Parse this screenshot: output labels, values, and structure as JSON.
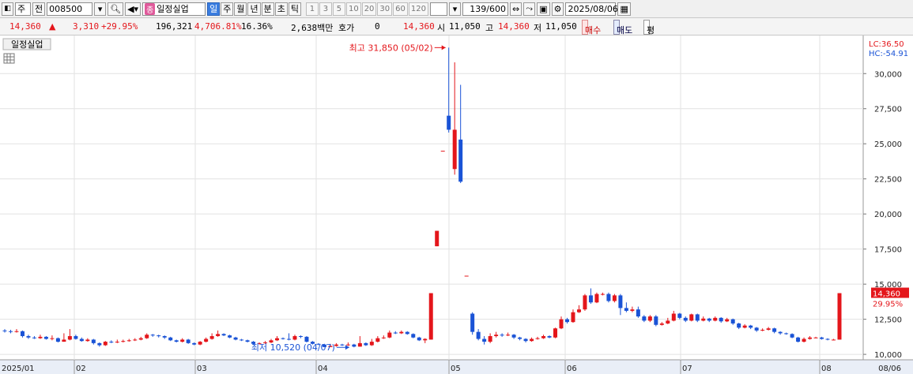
{
  "toolbar": {
    "menu_label": "주",
    "jeon_label": "전",
    "code": "008500",
    "badge": "종",
    "name": "일정실업",
    "periods": [
      "일",
      "주",
      "월",
      "년",
      "분",
      "초",
      "틱"
    ],
    "active_period": "일",
    "intervals": [
      "1",
      "3",
      "5",
      "10",
      "20",
      "30",
      "60",
      "120"
    ],
    "count": "139",
    "count_max": "/600",
    "date": "2025/08/06"
  },
  "quote": {
    "price": "14,360",
    "arrow": "up",
    "change": "3,310",
    "change_pct": "+29.95%",
    "volume": "196,321",
    "volume_ratio": "4,706.81%",
    "turnover": "16.36%",
    "amount": "2,638백만",
    "hoga_label": "호가",
    "hoga_value": "0",
    "hoga_price": "14,360",
    "open_label": "시",
    "open": "11,050",
    "high_label": "고",
    "high": "14,360",
    "low_label": "저",
    "low": "11,050",
    "buy_label": "매수",
    "sell_label": "매도",
    "avg_label": "평"
  },
  "chart_data": {
    "type": "candlestick",
    "title": "일정실업",
    "corner_labels": [
      "LC:36.50",
      "HC:-54.91"
    ],
    "y_ticks": [
      10000,
      12500,
      15000,
      17500,
      20000,
      22500,
      25000,
      27500,
      30000
    ],
    "ylim": [
      9500,
      32600
    ],
    "x_ticks": [
      "2025/01",
      "02",
      "03",
      "04",
      "05",
      "06",
      "07",
      "08",
      "08/06"
    ],
    "grid": true,
    "up_color": "#e4161b",
    "down_color": "#1a53d6",
    "max_annotation": "최고 31,850 (05/02)",
    "min_annotation": "최저 10,520 (04/07)",
    "last_price_label": "14,360",
    "last_change_label": "29.95%",
    "candles": [
      [
        11700,
        11650,
        11800,
        11550
      ],
      [
        11650,
        11600,
        11750,
        11500
      ],
      [
        11600,
        11650,
        11800,
        11550
      ],
      [
        11650,
        11300,
        11700,
        11200
      ],
      [
        11300,
        11200,
        11400,
        11100
      ],
      [
        11200,
        11150,
        11300,
        11100
      ],
      [
        11150,
        11250,
        11400,
        11100
      ],
      [
        11250,
        11100,
        11300,
        11050
      ],
      [
        11100,
        11150,
        11350,
        11000
      ],
      [
        11150,
        10900,
        11200,
        10850
      ],
      [
        10900,
        11050,
        11500,
        10900
      ],
      [
        11050,
        11300,
        11800,
        11000
      ],
      [
        11300,
        11100,
        11400,
        11050
      ],
      [
        11100,
        10950,
        11200,
        10900
      ],
      [
        10950,
        11050,
        11150,
        10900
      ],
      [
        11050,
        10800,
        11100,
        10700
      ],
      [
        10800,
        10650,
        10850,
        10550
      ],
      [
        10650,
        10900,
        10950,
        10600
      ],
      [
        10900,
        10850,
        11000,
        10800
      ],
      [
        10850,
        10900,
        11050,
        10800
      ],
      [
        10900,
        10950,
        11050,
        10850
      ],
      [
        10950,
        11000,
        11100,
        10900
      ],
      [
        11000,
        11050,
        11150,
        10950
      ],
      [
        11050,
        11150,
        11250,
        11000
      ],
      [
        11150,
        11400,
        11500,
        11100
      ],
      [
        11400,
        11350,
        11450,
        11250
      ],
      [
        11350,
        11300,
        11400,
        11200
      ],
      [
        11300,
        11200,
        11350,
        11100
      ],
      [
        11200,
        11000,
        11250,
        10950
      ],
      [
        11000,
        10900,
        11050,
        10850
      ],
      [
        10900,
        11050,
        11150,
        10850
      ],
      [
        11050,
        10800,
        11100,
        10750
      ],
      [
        10800,
        10700,
        10850,
        10650
      ],
      [
        10700,
        10900,
        10950,
        10650
      ],
      [
        10900,
        11100,
        11200,
        10850
      ],
      [
        11100,
        11300,
        11500,
        11050
      ],
      [
        11300,
        11450,
        11700,
        11250
      ],
      [
        11450,
        11350,
        11500,
        11300
      ],
      [
        11350,
        11200,
        11400,
        11150
      ],
      [
        11200,
        11050,
        11250,
        11000
      ],
      [
        11050,
        11000,
        11100,
        10950
      ],
      [
        11000,
        10900,
        11050,
        10850
      ],
      [
        10900,
        10750,
        10950,
        10700
      ],
      [
        10750,
        10800,
        10850,
        10700
      ],
      [
        10800,
        10850,
        10950,
        10750
      ],
      [
        10850,
        11000,
        11100,
        10800
      ],
      [
        11000,
        11150,
        11300,
        10950
      ],
      [
        11150,
        11100,
        11200,
        11050
      ],
      [
        11100,
        11050,
        11500,
        11000
      ],
      [
        11050,
        11300,
        11400,
        11000
      ],
      [
        11300,
        11250,
        11350,
        11150
      ],
      [
        11250,
        10900,
        11300,
        10850
      ],
      [
        10900,
        10750,
        10950,
        10700
      ],
      [
        10750,
        10700,
        10800,
        10650
      ],
      [
        10700,
        10520,
        10750,
        10520
      ],
      [
        10520,
        10600,
        10750,
        10520
      ],
      [
        10600,
        10700,
        10800,
        10550
      ],
      [
        10700,
        10650,
        10750,
        10600
      ],
      [
        10650,
        10700,
        10850,
        10600
      ],
      [
        10700,
        10550,
        10750,
        10500
      ],
      [
        10550,
        10800,
        11300,
        10550
      ],
      [
        10800,
        10650,
        10850,
        10600
      ],
      [
        10650,
        10900,
        11100,
        10600
      ],
      [
        10900,
        11150,
        11300,
        10850
      ],
      [
        11150,
        11200,
        11350,
        11100
      ],
      [
        11200,
        11550,
        11700,
        11150
      ],
      [
        11550,
        11500,
        11650,
        11450
      ],
      [
        11500,
        11600,
        11700,
        11450
      ],
      [
        11600,
        11450,
        11650,
        11400
      ],
      [
        11450,
        11200,
        11500,
        11150
      ],
      [
        11200,
        11000,
        11250,
        10950
      ],
      [
        11000,
        11100,
        11150,
        10800
      ],
      [
        11050,
        14360,
        14360,
        11050
      ],
      [
        17700,
        18800,
        18800,
        17700
      ],
      [
        24500,
        24500,
        24500,
        24500
      ],
      [
        27000,
        26000,
        31850,
        25800
      ],
      [
        23200,
        26000,
        30800,
        22800
      ],
      [
        25300,
        22300,
        29200,
        22200
      ],
      [
        15600,
        15600,
        15600,
        15600
      ],
      [
        12900,
        11600,
        13000,
        11400
      ],
      [
        11600,
        11100,
        11800,
        11000
      ],
      [
        11100,
        10900,
        11300,
        10700
      ],
      [
        10900,
        11300,
        11500,
        10800
      ],
      [
        11300,
        11400,
        11600,
        11200
      ],
      [
        11400,
        11350,
        11500,
        11250
      ],
      [
        11350,
        11400,
        11550,
        11300
      ],
      [
        11400,
        11200,
        11450,
        11100
      ],
      [
        11200,
        11100,
        11250,
        11000
      ],
      [
        11100,
        10950,
        11150,
        10850
      ],
      [
        10950,
        11100,
        11200,
        10900
      ],
      [
        11100,
        11150,
        11250,
        11050
      ],
      [
        11150,
        11300,
        11400,
        11100
      ],
      [
        11300,
        11200,
        11350,
        11150
      ],
      [
        11200,
        11850,
        11900,
        11150
      ],
      [
        11850,
        12500,
        12700,
        11800
      ],
      [
        12500,
        12300,
        12600,
        12200
      ],
      [
        12300,
        13000,
        13200,
        12250
      ],
      [
        13000,
        13200,
        13500,
        12950
      ],
      [
        13200,
        14200,
        14300,
        13100
      ],
      [
        14200,
        13700,
        14700,
        13600
      ],
      [
        13700,
        14300,
        14400,
        13650
      ],
      [
        14300,
        14300,
        14400,
        14200
      ],
      [
        14300,
        13800,
        14400,
        13700
      ],
      [
        13800,
        14200,
        14300,
        13700
      ],
      [
        14200,
        13300,
        14300,
        12800
      ],
      [
        13300,
        13100,
        13700,
        13000
      ],
      [
        13100,
        13200,
        13400,
        13000
      ],
      [
        13200,
        12700,
        13400,
        12600
      ],
      [
        12700,
        12400,
        12800,
        12300
      ],
      [
        12400,
        12700,
        12800,
        12300
      ],
      [
        12700,
        12100,
        12800,
        12000
      ],
      [
        12100,
        12200,
        12300,
        12050
      ],
      [
        12200,
        12400,
        12600,
        12150
      ],
      [
        12400,
        12900,
        13100,
        12350
      ],
      [
        12900,
        12600,
        12950,
        12500
      ],
      [
        12600,
        12400,
        12700,
        12300
      ],
      [
        12400,
        12850,
        12900,
        12350
      ],
      [
        12850,
        12400,
        12900,
        12300
      ],
      [
        12400,
        12550,
        12700,
        12350
      ],
      [
        12550,
        12400,
        12600,
        12300
      ],
      [
        12400,
        12600,
        12700,
        12350
      ],
      [
        12600,
        12350,
        12650,
        12250
      ],
      [
        12350,
        12500,
        12600,
        12300
      ],
      [
        12500,
        12200,
        12550,
        12100
      ],
      [
        12200,
        11900,
        12250,
        11800
      ],
      [
        11900,
        12050,
        12150,
        11850
      ],
      [
        12050,
        11900,
        12100,
        11800
      ],
      [
        11900,
        11700,
        11950,
        11600
      ],
      [
        11700,
        11750,
        11850,
        11650
      ],
      [
        11750,
        11850,
        11950,
        11700
      ],
      [
        11850,
        11600,
        11900,
        11500
      ],
      [
        11600,
        11500,
        11650,
        11400
      ],
      [
        11500,
        11450,
        11550,
        11400
      ],
      [
        11450,
        11200,
        11500,
        11150
      ],
      [
        11200,
        10900,
        11250,
        10850
      ],
      [
        10900,
        11100,
        11200,
        10850
      ],
      [
        11100,
        11200,
        11300,
        11050
      ],
      [
        11200,
        11200,
        11250,
        11150
      ],
      [
        11200,
        11100,
        11250,
        11050
      ],
      [
        11100,
        11050,
        11150,
        11000
      ],
      [
        11050,
        11050,
        11100,
        11000
      ],
      [
        11050,
        14360,
        14360,
        11050
      ]
    ]
  }
}
